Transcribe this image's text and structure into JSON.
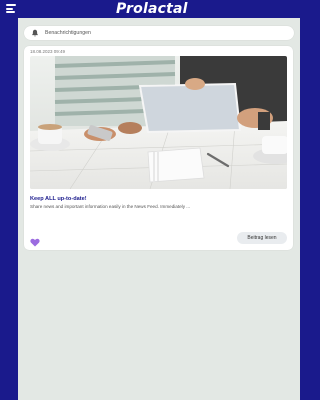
{
  "header": {
    "logo_text": "Prolactal"
  },
  "notifications": {
    "label": "Benachrichtigungen"
  },
  "post": {
    "date": "18.08.2023 09:49",
    "title": "Keep ALL up-to-date!",
    "description": "Share news and important information easily in the News Feed. Immediately ...",
    "read_button": "Beitrag lesen"
  },
  "colors": {
    "brand": "#1a1a8c",
    "background": "#e3e8e4",
    "like": "#9b6be0"
  },
  "icons": {
    "menu": "hamburger-icon",
    "bell": "bell-icon",
    "like": "heart-icon"
  }
}
